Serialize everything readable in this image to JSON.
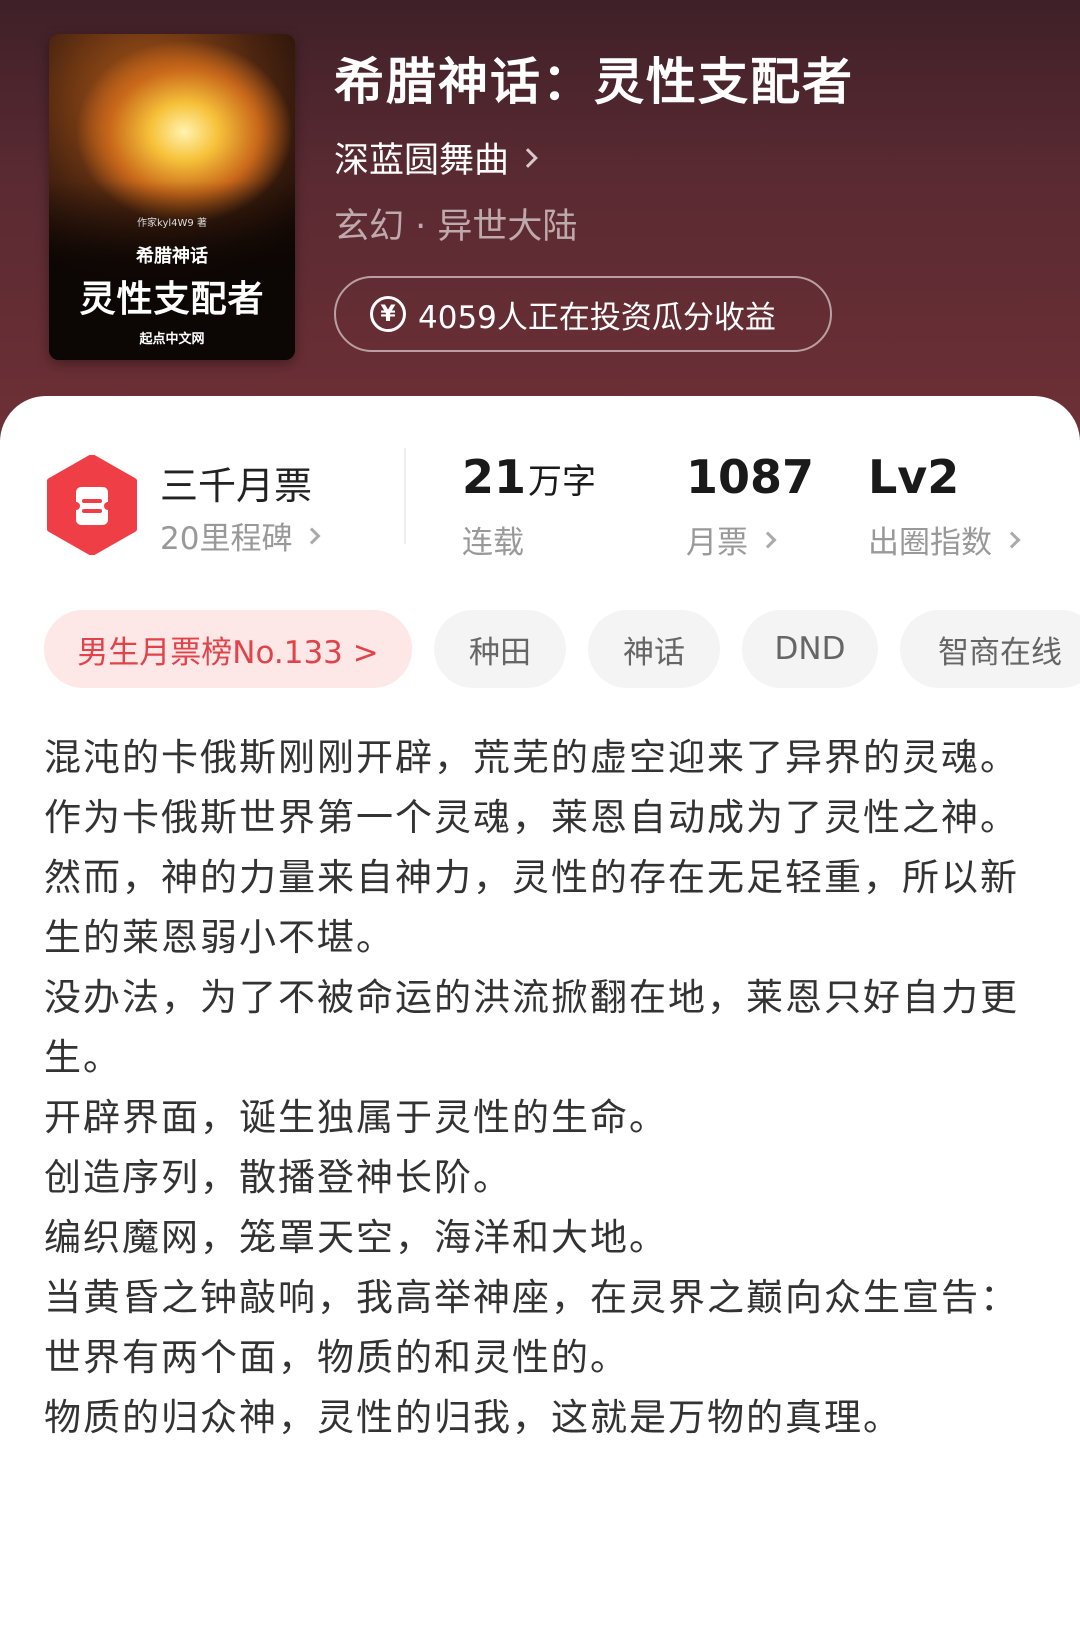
{
  "book": {
    "title": "希腊神话：灵性支配者",
    "author": "深蓝圆舞曲",
    "genre": "玄幻 · 异世大陆",
    "invest_text": "4059人正在投资瓜分收益",
    "cover": {
      "author_line": "作家kyl4W9 著",
      "subtitle": "希腊神话",
      "main_title": "灵性支配者",
      "publisher": "起点中文网"
    }
  },
  "stats": {
    "ticket_title": "三千月票",
    "ticket_sub": "20里程碑",
    "words_num": "21",
    "words_unit": "万字",
    "words_label": "连载",
    "monthly_num": "1087",
    "monthly_label": "月票",
    "level_num": "Lv2",
    "level_label": "出圈指数"
  },
  "tags": [
    "男生月票榜No.133 >",
    "种田",
    "神话",
    "DND",
    "智商在线"
  ],
  "description": [
    "混沌的卡俄斯刚刚开辟，荒芜的虚空迎来了异界的灵魂。",
    "作为卡俄斯世界第一个灵魂，莱恩自动成为了灵性之神。",
    "然而，神的力量来自神力，灵性的存在无足轻重，所以新生的莱恩弱小不堪。",
    "没办法，为了不被命运的洪流掀翻在地，莱恩只好自力更生。",
    "开辟界面，诞生独属于灵性的生命。",
    "创造序列，散播登神长阶。",
    "编织魔网，笼罩天空，海洋和大地。",
    "当黄昏之钟敲响，我高举神座，在灵界之巅向众生宣告：",
    "世界有两个面，物质的和灵性的。",
    "物质的归众神，灵性的归我，这就是万物的真理。"
  ],
  "colors": {
    "header_bg": "#5a2a32",
    "accent_red": "#e0434a",
    "badge_red": "#ef3e46"
  }
}
